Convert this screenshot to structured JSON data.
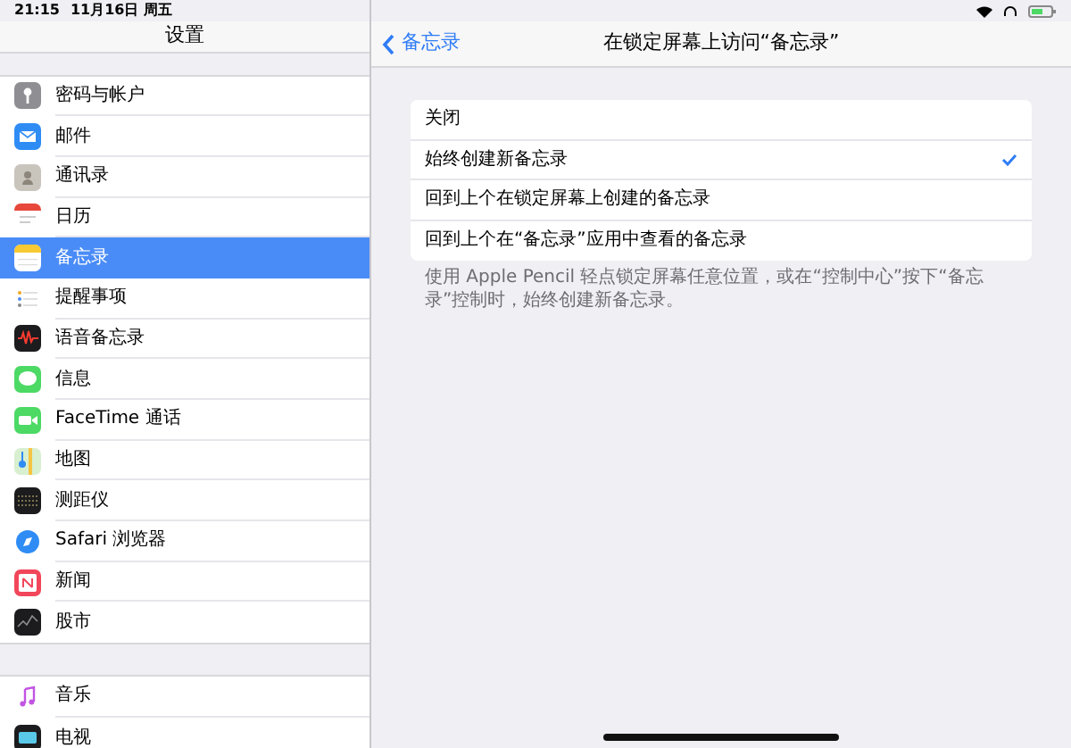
{
  "status_bar": {
    "time": "21:15",
    "date": "11月16日 周五"
  },
  "sidebar": {
    "title": "设置",
    "groups": [
      [
        {
          "label": "密码与帐户",
          "kind": "key",
          "selected": false
        },
        {
          "label": "邮件",
          "kind": "mail",
          "selected": false
        },
        {
          "label": "通讯录",
          "kind": "contacts",
          "selected": false
        },
        {
          "label": "日历",
          "kind": "calendar",
          "selected": false
        },
        {
          "label": "备忘录",
          "kind": "notes",
          "selected": true
        },
        {
          "label": "提醒事项",
          "kind": "reminders",
          "selected": false
        },
        {
          "label": "语音备忘录",
          "kind": "voice",
          "selected": false
        },
        {
          "label": "信息",
          "kind": "messages",
          "selected": false
        },
        {
          "label": "FaceTime 通话",
          "kind": "facetime",
          "selected": false
        },
        {
          "label": "地图",
          "kind": "maps",
          "selected": false
        },
        {
          "label": "测距仪",
          "kind": "measure",
          "selected": false
        },
        {
          "label": "Safari 浏览器",
          "kind": "safari",
          "selected": false
        },
        {
          "label": "新闻",
          "kind": "news",
          "selected": false
        },
        {
          "label": "股市",
          "kind": "stocks",
          "selected": false
        }
      ],
      [
        {
          "label": "音乐",
          "kind": "music",
          "selected": false
        },
        {
          "label": "电视",
          "kind": "tv",
          "selected": false
        }
      ]
    ]
  },
  "detail": {
    "back": "备忘录",
    "title": "在锁定屏幕上访问“备忘录”",
    "options": [
      {
        "label": "关闭",
        "selected": false
      },
      {
        "label": "始终创建新备忘录",
        "selected": true
      },
      {
        "label": "回到上个在锁定屏幕上创建的备忘录",
        "selected": false
      },
      {
        "label": "回到上个在“备忘录”应用中查看的备忘录",
        "selected": false
      }
    ],
    "footer": "使用 Apple Pencil 轻点锁定屏幕任意位置，或在“控制中心”按下“备忘录”控制时，始终创建新备忘录。"
  }
}
